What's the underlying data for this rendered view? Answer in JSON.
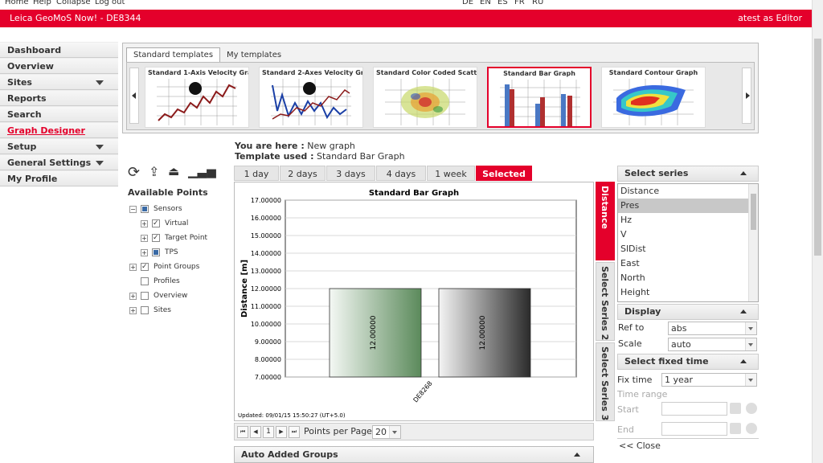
{
  "topnav": {
    "links": [
      "Home",
      "Help",
      "Collapse",
      "Log out"
    ],
    "langs": [
      "DE",
      "EN",
      "ES",
      "FR",
      "RU"
    ]
  },
  "titlebar": {
    "app": "Leica GeoMoS Now!  - DE8344",
    "user": "atest as Editor"
  },
  "sidebar": {
    "items": [
      {
        "label": "Dashboard",
        "caret": false,
        "active": false
      },
      {
        "label": "Overview",
        "caret": false,
        "active": false
      },
      {
        "label": "Sites",
        "caret": true,
        "active": false
      },
      {
        "label": "Reports",
        "caret": false,
        "active": false
      },
      {
        "label": "Search",
        "caret": false,
        "active": false
      },
      {
        "label": "Graph Designer",
        "caret": false,
        "active": true
      },
      {
        "label": "Setup",
        "caret": true,
        "active": false
      },
      {
        "label": "General Settings",
        "caret": true,
        "active": false
      },
      {
        "label": "My Profile",
        "caret": false,
        "active": false
      }
    ]
  },
  "templates": {
    "tabs": [
      "Standard templates",
      "My templates"
    ],
    "cards": [
      "Standard 1-Axis Velocity Gra...",
      "Standard 2-Axes Velocity Gr...",
      "Standard Color Coded Scatt...",
      "Standard Bar Graph",
      "Standard Contour Graph"
    ]
  },
  "points": {
    "title": "Available Points",
    "tree": [
      {
        "label": "Sensors",
        "level": 0,
        "pm": "−",
        "cb": "partial"
      },
      {
        "label": "Virtual",
        "level": 1,
        "pm": "+",
        "cb": "checked"
      },
      {
        "label": "Target Point",
        "level": 1,
        "pm": "+",
        "cb": "checked"
      },
      {
        "label": "TPS",
        "level": 1,
        "pm": "+",
        "cb": "partial"
      },
      {
        "label": "Point Groups",
        "level": 0,
        "pm": "+",
        "cb": "checked"
      },
      {
        "label": "Profiles",
        "level": 0,
        "pm": "",
        "cb": "none"
      },
      {
        "label": "Overview",
        "level": 0,
        "pm": "+",
        "cb": "none"
      },
      {
        "label": "Sites",
        "level": 0,
        "pm": "+",
        "cb": "none"
      }
    ]
  },
  "info": {
    "here_label": "You are here :",
    "here_value": "New graph",
    "used_label": "Template used :",
    "used_value": "Standard Bar Graph"
  },
  "range_tabs": [
    "1 day",
    "2 days",
    "3 days",
    "4 days",
    "1 week",
    "Selected"
  ],
  "chart_data": {
    "type": "bar",
    "title": "Standard Bar Graph",
    "ylabel": "Distance [m]",
    "ylim": [
      7,
      17
    ],
    "yticks": [
      "17.00000",
      "16.00000",
      "15.00000",
      "14.00000",
      "13.00000",
      "12.00000",
      "11.00000",
      "10.00000",
      "9.00000",
      "8.00000",
      "7.00000"
    ],
    "categories": [
      "DE8268"
    ],
    "series": [
      {
        "values": [
          12
        ],
        "label": "12.00000",
        "color_top": "#f4f8f4",
        "color_bottom": "#5b8a5b"
      },
      {
        "values": [
          12
        ],
        "label": "12.00000",
        "color_top": "#f4f4f4",
        "color_bottom": "#2b2b2b"
      }
    ],
    "updated": "Updated: 09/01/15 15:50:27 (UT+5.0)"
  },
  "pager": {
    "page": "1",
    "per_page_label": "Points per Page:",
    "per_page": "20"
  },
  "auto_groups": "Auto Added Groups",
  "vtabs": [
    "Distance",
    "Select Series 2",
    "Select Series 3"
  ],
  "series_panel": {
    "title": "Select series",
    "items": [
      "Distance",
      "Pres",
      "Hz",
      "V",
      "SlDist",
      "East",
      "North",
      "Height"
    ],
    "selected": "Pres"
  },
  "display": {
    "title": "Display",
    "ref_label": "Ref to",
    "ref_value": "abs",
    "scale_label": "Scale",
    "scale_value": "auto"
  },
  "fixed_time": {
    "title": "Select fixed time",
    "fix_label": "Fix time",
    "fix_value": "1 year",
    "range_label": "Time range",
    "start_label": "Start",
    "end_label": "End"
  },
  "close_label": "<< Close",
  "colors": {
    "brand": "#e4002b"
  }
}
